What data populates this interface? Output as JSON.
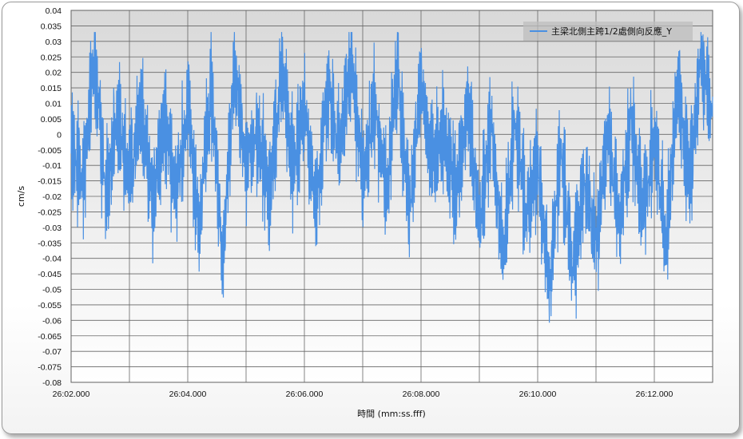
{
  "chart_data": {
    "type": "line",
    "title": "",
    "xlabel": "時間 (mm:ss.fff)",
    "ylabel": "cm/s",
    "ylim": [
      -0.08,
      0.04
    ],
    "y_ticks": [
      "0.04",
      "0.035",
      "0.03",
      "0.025",
      "0.02",
      "0.015",
      "0.01",
      "0.005",
      "0",
      "-0.005",
      "-0.01",
      "-0.015",
      "-0.02",
      "-0.025",
      "-0.03",
      "-0.035",
      "-0.04",
      "-0.045",
      "-0.05",
      "-0.055",
      "-0.06",
      "-0.065",
      "-0.07",
      "-0.075",
      "-0.08"
    ],
    "xlim_seconds": [
      1562.0,
      1573.0
    ],
    "x_ticks": [
      "26:02.000",
      "26:04.000",
      "26:06.000",
      "26:08.000",
      "26:10.000",
      "26:12.000"
    ],
    "grid": true,
    "legend_position": "top-right",
    "series": [
      {
        "name": "主梁北側主跨1/2處側向反應_Y",
        "color": "#4a90e2",
        "x_seconds": [
          1562.0,
          1562.2,
          1562.4,
          1562.6,
          1562.8,
          1563.0,
          1563.2,
          1563.4,
          1563.6,
          1563.8,
          1564.0,
          1564.2,
          1564.4,
          1564.6,
          1564.8,
          1565.0,
          1565.2,
          1565.4,
          1565.6,
          1565.8,
          1566.0,
          1566.2,
          1566.4,
          1566.6,
          1566.8,
          1567.0,
          1567.2,
          1567.4,
          1567.6,
          1567.8,
          1568.0,
          1568.2,
          1568.4,
          1568.6,
          1568.8,
          1569.0,
          1569.2,
          1569.4,
          1569.6,
          1569.8,
          1570.0,
          1570.2,
          1570.4,
          1570.6,
          1570.8,
          1571.0,
          1571.2,
          1571.4,
          1571.6,
          1571.8,
          1572.0,
          1572.2,
          1572.4,
          1572.6,
          1572.8,
          1573.0
        ],
        "values": [
          -0.005,
          -0.015,
          0.025,
          -0.02,
          0.005,
          -0.015,
          0.01,
          -0.025,
          0.005,
          -0.02,
          0.01,
          -0.03,
          0.015,
          -0.04,
          0.02,
          -0.01,
          0.0,
          -0.02,
          0.02,
          -0.01,
          0.01,
          -0.025,
          0.015,
          -0.005,
          0.025,
          -0.015,
          0.01,
          -0.02,
          0.02,
          -0.025,
          0.015,
          -0.01,
          0.0,
          -0.02,
          0.01,
          -0.03,
          0.005,
          -0.04,
          0.005,
          -0.025,
          -0.01,
          -0.05,
          -0.005,
          -0.045,
          -0.015,
          -0.035,
          0.0,
          -0.03,
          0.005,
          -0.025,
          0.0,
          -0.035,
          0.015,
          -0.015,
          0.025,
          0.005
        ]
      }
    ]
  }
}
